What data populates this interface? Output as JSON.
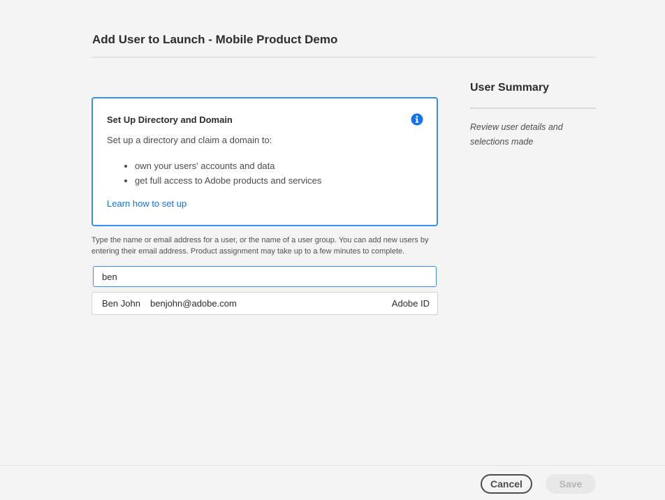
{
  "dialog": {
    "title": "Add User to Launch - Mobile Product Demo"
  },
  "info_card": {
    "title": "Set Up Directory and Domain",
    "intro": "Set up a directory and claim a domain to:",
    "bullets": [
      "own your users' accounts and data",
      "get full access to Adobe products and services"
    ],
    "link_label": "Learn how to set up",
    "icon": "info-icon",
    "accent_color": "#378ef0"
  },
  "help_text": "Type the name or email address for a user, or the name of a user group. You can add new users by entering their email address. Product assignment may take up to a few minutes to complete.",
  "search": {
    "value": "ben",
    "placeholder": ""
  },
  "suggestions": [
    {
      "name": "Ben John",
      "email": "benjohn@adobe.com",
      "type": "Adobe ID"
    }
  ],
  "summary": {
    "title": "User Summary",
    "description": "Review user details and selections made"
  },
  "footer": {
    "cancel_label": "Cancel",
    "save_label": "Save"
  },
  "colors": {
    "link": "#1473e6",
    "focus_border": "#378ef0",
    "background": "#f4f4f4"
  }
}
